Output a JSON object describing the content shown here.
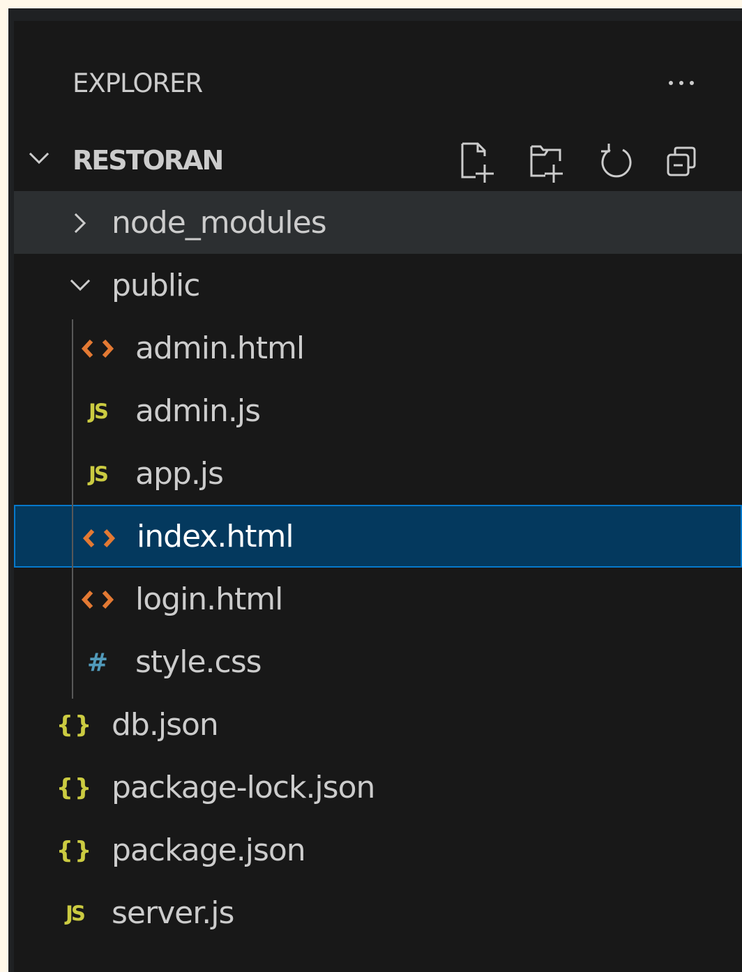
{
  "explorer": {
    "title": "EXPLORER",
    "more_icon": "ellipsis-icon"
  },
  "project": {
    "name": "RESTORAN",
    "actions": [
      {
        "name": "New File",
        "icon": "new-file-icon"
      },
      {
        "name": "New Folder",
        "icon": "new-folder-icon"
      },
      {
        "name": "Refresh Explorer",
        "icon": "refresh-icon"
      },
      {
        "name": "Collapse Folders in Explorer",
        "icon": "collapse-all-icon"
      }
    ]
  },
  "tree": {
    "node_modules": "node_modules",
    "public": "public",
    "public_files": [
      {
        "name": "admin.html",
        "icon": "html-file-icon"
      },
      {
        "name": "admin.js",
        "icon": "javascript-file-icon"
      },
      {
        "name": "app.js",
        "icon": "javascript-file-icon"
      },
      {
        "name": "index.html",
        "icon": "html-file-icon",
        "selected": true
      },
      {
        "name": "login.html",
        "icon": "html-file-icon"
      },
      {
        "name": "style.css",
        "icon": "css-file-icon"
      }
    ],
    "root_files": [
      {
        "name": "db.json",
        "icon": "json-file-icon"
      },
      {
        "name": "package-lock.json",
        "icon": "json-file-icon"
      },
      {
        "name": "package.json",
        "icon": "json-file-icon"
      },
      {
        "name": "server.js",
        "icon": "javascript-file-icon"
      }
    ]
  },
  "icons": {
    "javascript": "JS",
    "css": "#",
    "json": "{}"
  },
  "colors": {
    "page_background": "#fff8e9",
    "panel_background": "#181818",
    "hover_background": "#2c2f31",
    "selected_background": "#04395e",
    "selected_border": "#0679cc",
    "html_icon": "#e37933",
    "javascript_icon": "#cbcb41",
    "css_icon": "#519aba",
    "json_icon": "#cbcb41"
  }
}
